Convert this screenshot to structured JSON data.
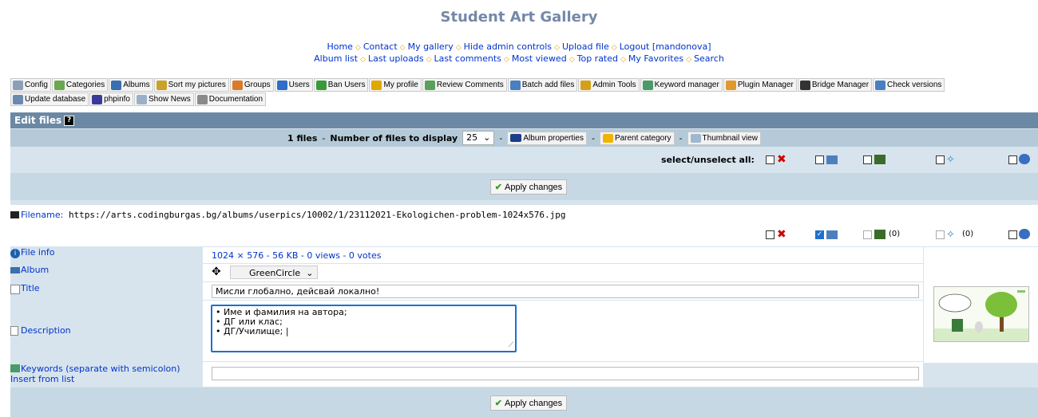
{
  "site_title": "Student Art Gallery",
  "nav1": [
    "Home",
    "Contact",
    "My gallery",
    "Hide admin controls",
    "Upload file",
    "Logout [mandonova]"
  ],
  "nav2": [
    "Album list",
    "Last uploads",
    "Last comments",
    "Most viewed",
    "Top rated",
    "My Favorites",
    "Search"
  ],
  "admin_toolbar": {
    "row1": [
      {
        "label": "Config",
        "icon": "gear-icon",
        "color": "#8aa0b8"
      },
      {
        "label": "Categories",
        "icon": "tree-icon",
        "color": "#6aa84f"
      },
      {
        "label": "Albums",
        "icon": "albums-icon",
        "color": "#3a6fb0"
      },
      {
        "label": "Sort my pictures",
        "icon": "sort-icon",
        "color": "#c9a227"
      },
      {
        "label": "Groups",
        "icon": "groups-icon",
        "color": "#d97b2a"
      },
      {
        "label": "Users",
        "icon": "user-icon",
        "color": "#2f6dc9"
      },
      {
        "label": "Ban Users",
        "icon": "ban-users-icon",
        "color": "#3a9a3a"
      },
      {
        "label": "My profile",
        "icon": "profile-icon",
        "color": "#e0a800"
      },
      {
        "label": "Review Comments",
        "icon": "comments-icon",
        "color": "#5aa05a"
      },
      {
        "label": "Batch add files",
        "icon": "batch-icon",
        "color": "#4a7fc1"
      },
      {
        "label": "Admin Tools",
        "icon": "tools-icon",
        "color": "#d4a017"
      },
      {
        "label": "Keyword manager",
        "icon": "keyword-icon",
        "color": "#4a9a6a"
      },
      {
        "label": "Plugin Manager",
        "icon": "plugin-icon",
        "color": "#e09a2a"
      },
      {
        "label": "Bridge Manager",
        "icon": "bridge-icon",
        "color": "#333333"
      },
      {
        "label": "Check versions",
        "icon": "versions-icon",
        "color": "#4a7fc1"
      }
    ],
    "row2": [
      {
        "label": "Update database",
        "icon": "database-icon",
        "color": "#6a8ab0"
      },
      {
        "label": "phpinfo",
        "icon": "php-icon",
        "color": "#3a3a9a"
      },
      {
        "label": "Show News",
        "icon": "news-icon",
        "color": "#9ab0c8"
      },
      {
        "label": "Documentation",
        "icon": "docs-icon",
        "color": "#8a8a8a"
      }
    ]
  },
  "panel_title": "Edit files",
  "help_mark": "?",
  "files_count": "1 files",
  "files_to_display_label": "Number of files to display",
  "files_to_display_value": "25",
  "dash": "-",
  "album_properties": "Album properties",
  "parent_category": "Parent category",
  "thumbnail_view": "Thumbnail view",
  "select_all": "select/unselect all:",
  "apply": "Apply changes",
  "filename_label": "Filename:",
  "filename": "https://arts.codingburgas.bg/albums/userpics/10002/1/23112021-Ekologichen-problem-1024x576.jpg",
  "counts": {
    "c3": "(0)",
    "c4": "(0)"
  },
  "file_info_label": "File info",
  "file_info": "1024 × 576 - 56 KB - 0 views - 0 votes",
  "album_label": "Album",
  "album_value": "GreenCircle",
  "title_label": "Title",
  "title_value": "Мисли глобално, дейсвай локално!",
  "description_label": "Description",
  "description_lines": [
    "• Име и фамилия на автора;",
    "• ДГ или клас;",
    "• ДГ/Училище; |"
  ],
  "keywords_label": "Keywords (separate with semicolon)",
  "insert_from_list": "Insert from list",
  "keywords_value": "",
  "accent": "#6b89a4"
}
